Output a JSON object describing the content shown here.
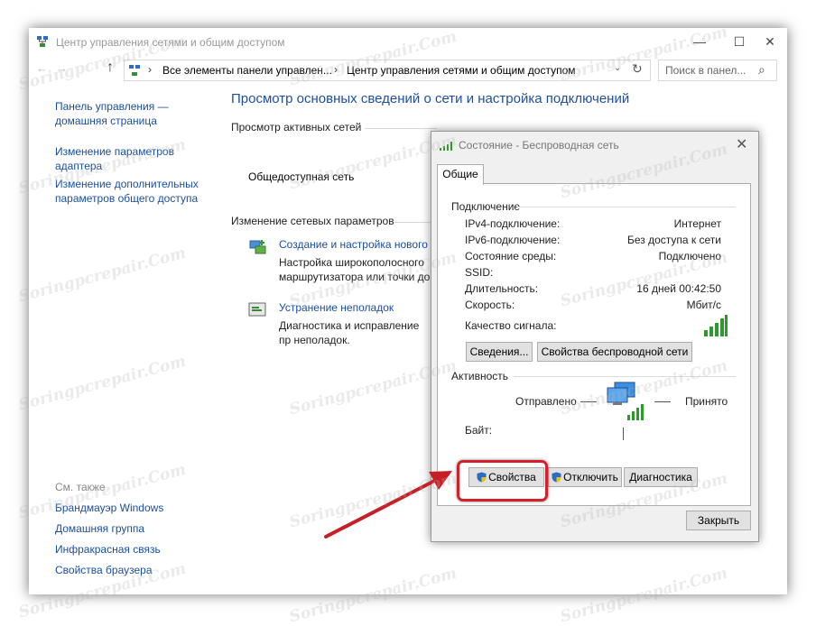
{
  "window": {
    "title": "Центр управления сетями и общим доступом",
    "minimize": "—",
    "maximize": "☐",
    "close": "✕"
  },
  "address": {
    "back": "←",
    "forward": "→",
    "up": "↑",
    "sep": "›",
    "crumbs": [
      "Все элементы панели управлен...",
      "Центр управления сетями и общим доступом"
    ],
    "dropdown": "⌄",
    "refresh": "↻",
    "search_placeholder": "Поиск в панел...",
    "search_icon": "⌕"
  },
  "sidebar": {
    "links": [
      {
        "label": "Панель управления — домашняя страница"
      },
      {
        "label": "Изменение параметров адаптера"
      },
      {
        "label": "Изменение дополнительных параметров общего доступа"
      }
    ],
    "see_also_title": "См. также",
    "see_also": [
      {
        "label": "Брандмауэр Windows"
      },
      {
        "label": "Домашняя группа"
      },
      {
        "label": "Инфракрасная связь"
      },
      {
        "label": "Свойства браузера"
      }
    ]
  },
  "main": {
    "heading": "Просмотр основных сведений о сети и настройка подключений",
    "active_networks_label": "Просмотр активных сетей",
    "network_category": "Общедоступная сеть",
    "change_settings_label": "Изменение сетевых параметров",
    "tasks": [
      {
        "title": "Создание и настройка нового",
        "desc": "Настройка широкополосного маршрутизатора или точки до"
      },
      {
        "title": "Устранение неполадок",
        "desc": "Диагностика и исправление пр неполадок."
      }
    ]
  },
  "dialog": {
    "title": "Состояние - Беспроводная сеть",
    "close": "✕",
    "tab": "Общие",
    "connection_group": "Подключение",
    "rows": [
      {
        "label": "IPv4-подключение:",
        "value": "Интернет"
      },
      {
        "label": "IPv6-подключение:",
        "value": "Без доступа к сети"
      },
      {
        "label": "Состояние среды:",
        "value": "Подключено"
      },
      {
        "label": "SSID:",
        "value": ""
      },
      {
        "label": "Длительность:",
        "value": "16 дней 00:42:50"
      },
      {
        "label": "Скорость:",
        "value": "Мбит/с"
      }
    ],
    "signal_quality_label": "Качество сигнала:",
    "signal_bars": 5,
    "details_button": "Сведения...",
    "wireless_props_button": "Свойства беспроводной сети",
    "activity_group": "Активность",
    "sent_label": "Отправлено",
    "received_label": "Принято",
    "bytes_label": "Байт:",
    "properties_button": "Свойства",
    "disable_button": "Отключить",
    "diagnose_button": "Диагностика",
    "close_button": "Закрыть"
  },
  "watermark_text": "Soringpcrepair.Com",
  "colors": {
    "link": "#1a4f9c",
    "heading": "#1e4f9d",
    "highlight": "#d32029",
    "signal": "#2e9a2e"
  }
}
